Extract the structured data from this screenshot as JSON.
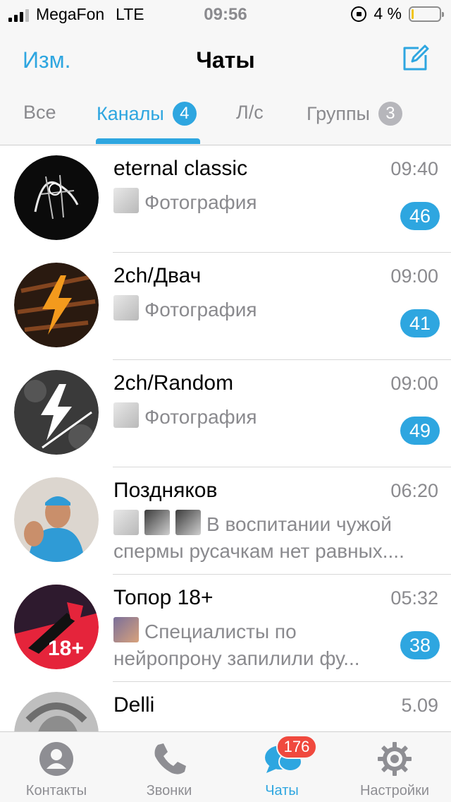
{
  "status_bar": {
    "carrier": "MegaFon",
    "network": "LTE",
    "time": "09:56",
    "battery": "4 %",
    "battery_level": 0.04
  },
  "nav": {
    "edit_label": "Изм.",
    "title": "Чаты",
    "compose_icon": "compose-icon"
  },
  "filters": [
    {
      "label": "Все",
      "badge": ""
    },
    {
      "label": "Каналы",
      "badge": "4"
    },
    {
      "label": "Л/с",
      "badge": ""
    },
    {
      "label": "Группы",
      "badge": "3"
    }
  ],
  "active_filter": "Каналы",
  "chats": [
    {
      "name": "eternal classic",
      "time": "09:40",
      "message": "Фотография",
      "unread": "46"
    },
    {
      "name": "2ch/Двач",
      "time": "09:00",
      "message": "Фотография",
      "unread": "41"
    },
    {
      "name": "2ch/Random",
      "time": "09:00",
      "message": "Фотография",
      "unread": "49"
    },
    {
      "name": "Поздняков",
      "time": "06:20",
      "message": "В воспитании чужой спермы русачкам нет равных....",
      "unread": ""
    },
    {
      "name": "Топор 18+",
      "time": "05:32",
      "message": "Специалисты по нейропрону запилили фу...",
      "unread": "38"
    },
    {
      "name": "Delli",
      "time": "5.09",
      "message": "",
      "unread": ""
    }
  ],
  "tabbar": [
    {
      "label": "Контакты",
      "icon": "contacts-icon"
    },
    {
      "label": "Звонки",
      "icon": "phone-icon"
    },
    {
      "label": "Чаты",
      "icon": "chats-icon",
      "badge": "176"
    },
    {
      "label": "Настройки",
      "icon": "settings-gear-icon"
    }
  ],
  "colors": {
    "accent": "#2ea6e0",
    "badge_red": "#f0493e",
    "muted": "#8a8a8e"
  }
}
